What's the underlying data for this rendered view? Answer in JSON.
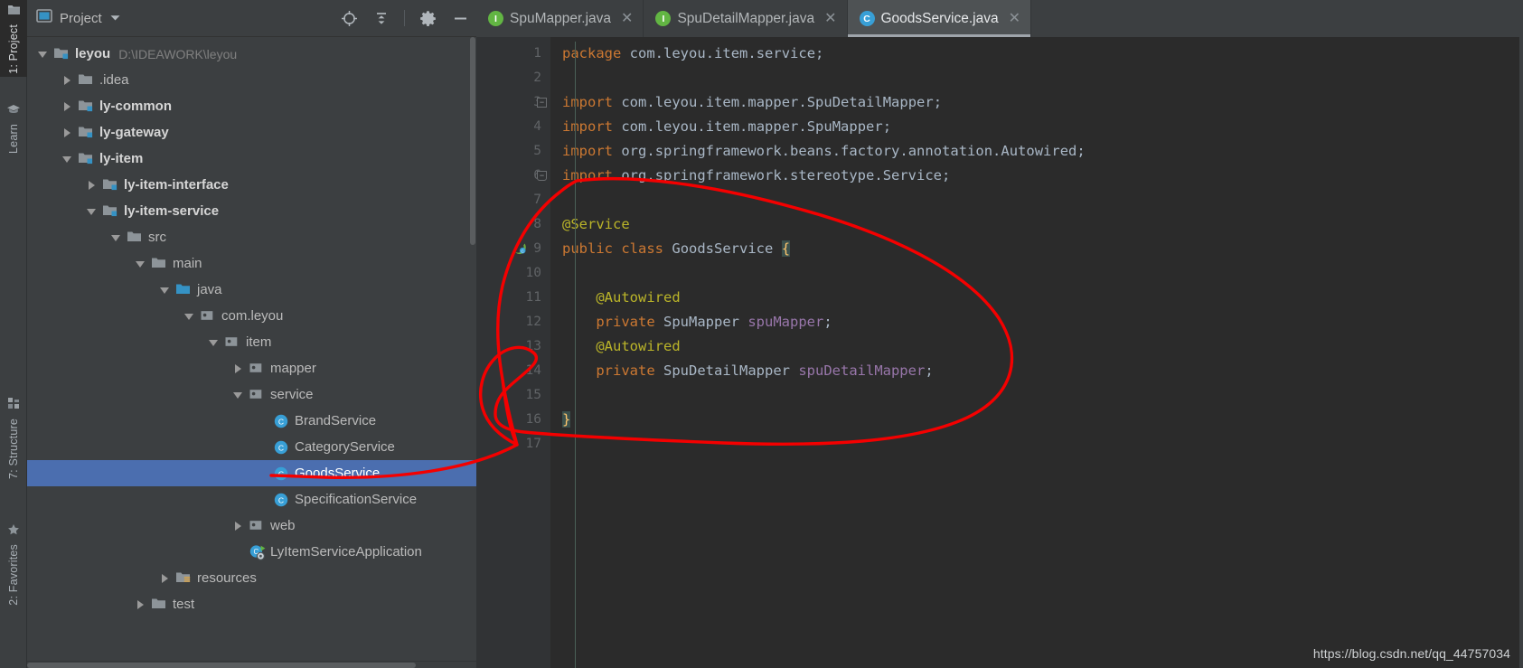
{
  "activity_bar": {
    "tabs": [
      {
        "label": "1: Project",
        "icon": "folder-icon",
        "selected": true
      },
      {
        "label": "Learn",
        "icon": "graduation-cap-icon",
        "selected": false
      },
      {
        "label": "7: Structure",
        "icon": "structure-icon",
        "selected": false
      },
      {
        "label": "2: Favorites",
        "icon": "favorites-icon",
        "selected": false
      }
    ]
  },
  "project_panel": {
    "title": "Project",
    "title_icon": "project-view-icon",
    "dropdown_icon": "chevron-down-icon",
    "tools": [
      {
        "name": "locate-icon",
        "tooltip": "Select Opened File"
      },
      {
        "name": "collapse-all-icon",
        "tooltip": "Collapse All"
      },
      {
        "name": "gear-icon",
        "tooltip": "Settings"
      },
      {
        "name": "minimize-icon",
        "tooltip": "Hide"
      }
    ],
    "tree": [
      {
        "label": "leyou",
        "sublabel": "D:\\IDEAWORK\\leyou",
        "depth": 0,
        "arrow": "down",
        "icon": "module-folder-icon",
        "bold": true,
        "selected": false
      },
      {
        "label": ".idea",
        "sublabel": "",
        "depth": 1,
        "arrow": "right",
        "icon": "folder-icon",
        "bold": false,
        "selected": false
      },
      {
        "label": "ly-common",
        "sublabel": "",
        "depth": 1,
        "arrow": "right",
        "icon": "module-folder-icon",
        "bold": true,
        "selected": false
      },
      {
        "label": "ly-gateway",
        "sublabel": "",
        "depth": 1,
        "arrow": "right",
        "icon": "module-folder-icon",
        "bold": true,
        "selected": false
      },
      {
        "label": "ly-item",
        "sublabel": "",
        "depth": 1,
        "arrow": "down",
        "icon": "module-folder-icon",
        "bold": true,
        "selected": false
      },
      {
        "label": "ly-item-interface",
        "sublabel": "",
        "depth": 2,
        "arrow": "right",
        "icon": "module-folder-icon",
        "bold": true,
        "selected": false
      },
      {
        "label": "ly-item-service",
        "sublabel": "",
        "depth": 2,
        "arrow": "down",
        "icon": "module-folder-icon",
        "bold": true,
        "selected": false
      },
      {
        "label": "src",
        "sublabel": "",
        "depth": 3,
        "arrow": "down",
        "icon": "folder-icon",
        "bold": false,
        "selected": false
      },
      {
        "label": "main",
        "sublabel": "",
        "depth": 4,
        "arrow": "down",
        "icon": "folder-icon",
        "bold": false,
        "selected": false
      },
      {
        "label": "java",
        "sublabel": "",
        "depth": 5,
        "arrow": "down",
        "icon": "source-root-folder-icon",
        "bold": false,
        "selected": false
      },
      {
        "label": "com.leyou",
        "sublabel": "",
        "depth": 6,
        "arrow": "down",
        "icon": "package-icon",
        "bold": false,
        "selected": false
      },
      {
        "label": "item",
        "sublabel": "",
        "depth": 7,
        "arrow": "down",
        "icon": "package-icon",
        "bold": false,
        "selected": false
      },
      {
        "label": "mapper",
        "sublabel": "",
        "depth": 8,
        "arrow": "right",
        "icon": "package-icon",
        "bold": false,
        "selected": false
      },
      {
        "label": "service",
        "sublabel": "",
        "depth": 8,
        "arrow": "down",
        "icon": "package-icon",
        "bold": false,
        "selected": false
      },
      {
        "label": "BrandService",
        "sublabel": "",
        "depth": 9,
        "arrow": "none",
        "icon": "java-class-icon",
        "bold": false,
        "selected": false
      },
      {
        "label": "CategoryService",
        "sublabel": "",
        "depth": 9,
        "arrow": "none",
        "icon": "java-class-icon",
        "bold": false,
        "selected": false
      },
      {
        "label": "GoodsService",
        "sublabel": "",
        "depth": 9,
        "arrow": "none",
        "icon": "java-class-icon",
        "bold": false,
        "selected": true
      },
      {
        "label": "SpecificationService",
        "sublabel": "",
        "depth": 9,
        "arrow": "none",
        "icon": "java-class-icon",
        "bold": false,
        "selected": false
      },
      {
        "label": "web",
        "sublabel": "",
        "depth": 8,
        "arrow": "right",
        "icon": "package-icon",
        "bold": false,
        "selected": false
      },
      {
        "label": "LyItemServiceApplication",
        "sublabel": "",
        "depth": 8,
        "arrow": "none",
        "icon": "spring-boot-class-icon",
        "bold": false,
        "selected": false
      },
      {
        "label": "resources",
        "sublabel": "",
        "depth": 5,
        "arrow": "right",
        "icon": "resources-folder-icon",
        "bold": false,
        "selected": false
      },
      {
        "label": "test",
        "sublabel": "",
        "depth": 4,
        "arrow": "right",
        "icon": "folder-icon",
        "bold": false,
        "selected": false
      }
    ]
  },
  "editor": {
    "tabs": [
      {
        "label": "SpuMapper.java",
        "icon": "java-interface-icon",
        "badge": "I",
        "active": false,
        "closable": true
      },
      {
        "label": "SpuDetailMapper.java",
        "icon": "java-interface-icon",
        "badge": "I",
        "active": false,
        "closable": true
      },
      {
        "label": "GoodsService.java",
        "icon": "java-class-icon",
        "badge": "C",
        "active": true,
        "closable": true
      }
    ],
    "line_numbers": [
      1,
      2,
      3,
      4,
      5,
      6,
      7,
      8,
      9,
      10,
      11,
      12,
      13,
      14,
      15,
      16,
      17
    ],
    "gutter_markers": [
      {
        "line": 3,
        "marker": "fold-minus-icon"
      },
      {
        "line": 6,
        "marker": "fold-end-icon"
      },
      {
        "line": 9,
        "marker": "spring-bean-icon"
      }
    ],
    "code_lines": [
      {
        "line": 1,
        "text": "package com.leyou.item.service;"
      },
      {
        "line": 2,
        "text": ""
      },
      {
        "line": 3,
        "text": "import com.leyou.item.mapper.SpuDetailMapper;"
      },
      {
        "line": 4,
        "text": "import com.leyou.item.mapper.SpuMapper;"
      },
      {
        "line": 5,
        "text": "import org.springframework.beans.factory.annotation.Autowired;"
      },
      {
        "line": 6,
        "text": "import org.springframework.stereotype.Service;"
      },
      {
        "line": 7,
        "text": ""
      },
      {
        "line": 8,
        "text": "@Service"
      },
      {
        "line": 9,
        "text": "public class GoodsService {"
      },
      {
        "line": 10,
        "text": ""
      },
      {
        "line": 11,
        "text": "    @Autowired"
      },
      {
        "line": 12,
        "text": "    private SpuMapper spuMapper;"
      },
      {
        "line": 13,
        "text": "    @Autowired"
      },
      {
        "line": 14,
        "text": "    private SpuDetailMapper spuDetailMapper;"
      },
      {
        "line": 15,
        "text": ""
      },
      {
        "line": 16,
        "text": "}"
      },
      {
        "line": 17,
        "text": ""
      }
    ]
  },
  "annotation": {
    "shape": "hand-drawn-red-loop-with-pointer",
    "color": "#f40000"
  },
  "watermark": {
    "text": "https://blog.csdn.net/qq_44757034"
  },
  "colors": {
    "panel_bg": "#3c3f41",
    "editor_bg": "#2b2b2b",
    "gutter_bg": "#313335",
    "selection_blue": "#4b6eaf",
    "accent_blue": "#389fd6",
    "interface_green": "#62b543",
    "keyword_orange": "#cc7832",
    "annotation_yellow": "#bbb529",
    "field_purple": "#9876aa",
    "text_gray": "#a9b7c6",
    "annot_red": "#f40000"
  }
}
